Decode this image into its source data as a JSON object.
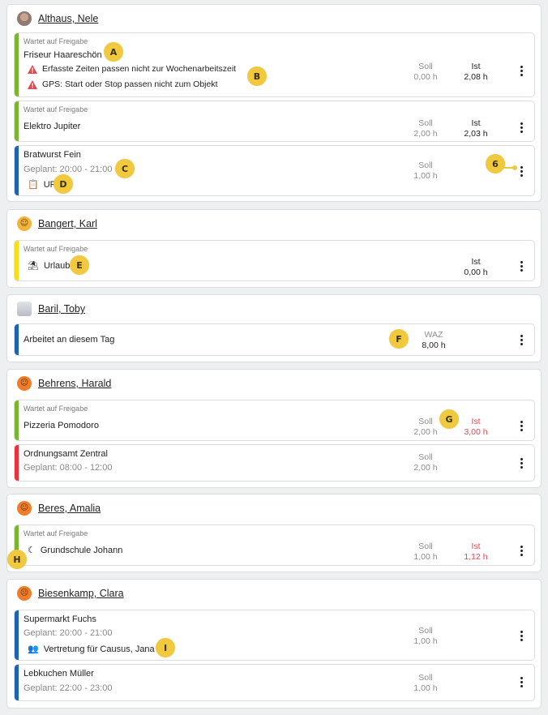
{
  "persons": [
    {
      "name": "Althaus, Nele",
      "entries": [
        {
          "status": "Wartet auf Freigabe",
          "title": "Friseur Haareschön",
          "warnings": [
            "Erfasste Zeiten passen nicht zur Wochenarbeitszeit",
            "GPS: Start oder Stop passen nicht zum Objekt"
          ],
          "soll_label": "Soll",
          "soll": "0,00 h",
          "ist_label": "Ist",
          "ist": "2,08 h"
        },
        {
          "status": "Wartet auf Freigabe",
          "title": "Elektro Jupiter",
          "soll_label": "Soll",
          "soll": "2,00 h",
          "ist_label": "Ist",
          "ist": "2,03 h"
        },
        {
          "title": "Bratwurst Fein",
          "planned": "Geplant: 20:00 - 21:00",
          "tag": "UR",
          "soll_label": "Soll",
          "soll": "1,00 h"
        }
      ]
    },
    {
      "name": "Bangert, Karl",
      "entries": [
        {
          "status": "Wartet auf Freigabe",
          "title": "Urlaub",
          "ist_label": "Ist",
          "ist": "0,00 h"
        }
      ]
    },
    {
      "name": "Baril, Toby",
      "entries": [
        {
          "title": "Arbeitet an diesem Tag",
          "waz_label": "WAZ",
          "waz": "8,00 h"
        }
      ]
    },
    {
      "name": "Behrens, Harald",
      "entries": [
        {
          "status": "Wartet auf Freigabe",
          "title": "Pizzeria Pomodoro",
          "soll_label": "Soll",
          "soll": "2,00 h",
          "ist_label": "Ist",
          "ist": "3,00 h"
        },
        {
          "title": "Ordnungsamt Zentral",
          "planned": "Geplant: 08:00 - 12:00",
          "soll_label": "Soll",
          "soll": "2,00 h"
        }
      ]
    },
    {
      "name": "Beres, Amalia",
      "entries": [
        {
          "status": "Wartet auf Freigabe",
          "title": "Grundschule Johann",
          "soll_label": "Soll",
          "soll": "1,00 h",
          "ist_label": "Ist",
          "ist": "1,12 h"
        }
      ]
    },
    {
      "name": "Biesenkamp, Clara",
      "entries": [
        {
          "title": "Supermarkt Fuchs",
          "planned": "Geplant: 20:00 - 21:00",
          "note": "Vertretung für Causus, Jana",
          "soll_label": "Soll",
          "soll": "1,00 h"
        },
        {
          "title": "Lebkuchen Müller",
          "planned": "Geplant: 22:00 - 23:00",
          "soll_label": "Soll",
          "soll": "1,00 h"
        }
      ]
    }
  ],
  "markers": [
    "A",
    "B",
    "C",
    "D",
    "E",
    "F",
    "G",
    "H",
    "I",
    "6"
  ],
  "colors": {
    "approved_pending": "#7bb431",
    "planned": "#1d63b0",
    "absence": "#f4df1a",
    "missed": "#e8323c",
    "overtime_text": "#e04a55",
    "marker": "#f1c93e"
  }
}
